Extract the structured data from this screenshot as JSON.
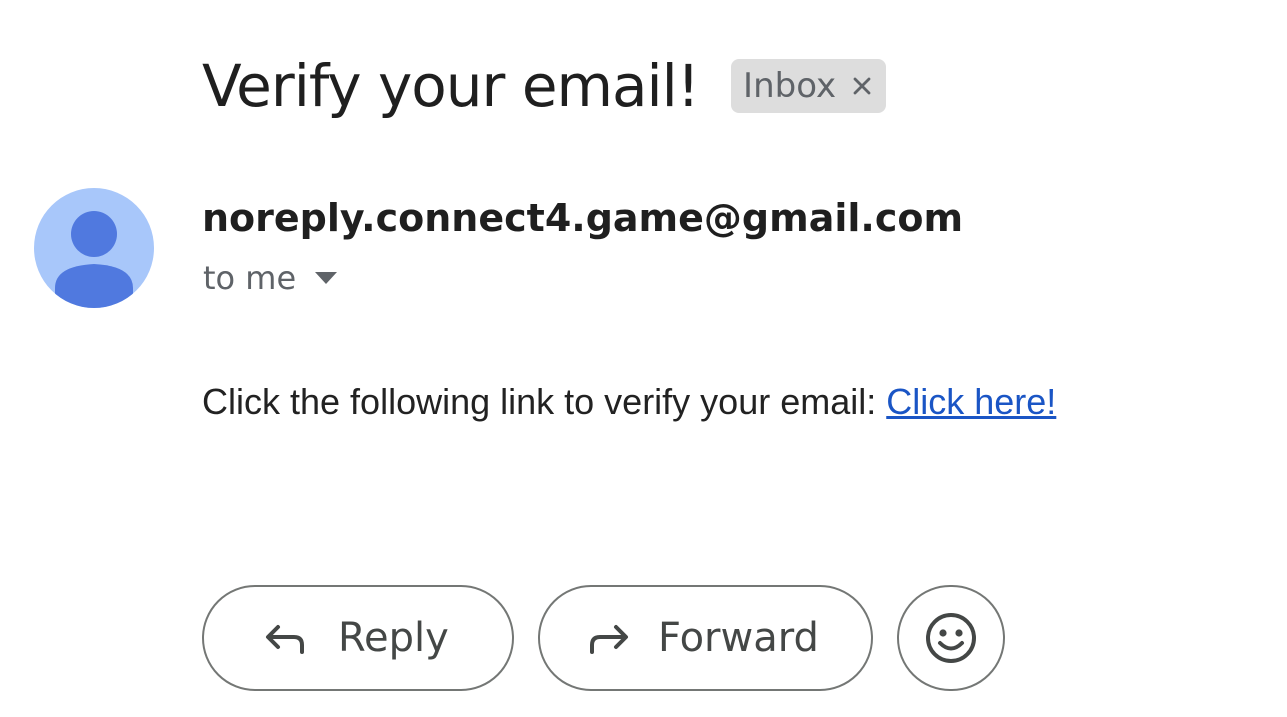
{
  "message": {
    "subject": "Verify your email!",
    "label": "Inbox",
    "sender": "noreply.connect4.game@gmail.com",
    "recipient": "to me",
    "body_text": "Click the following link to verify your email: ",
    "link_text": "Click here!"
  },
  "actions": {
    "reply_label": "Reply",
    "forward_label": "Forward"
  },
  "icons": {
    "label_remove": "close-icon",
    "avatar": "person-icon",
    "details": "caret-down-icon",
    "reply": "reply-arrow-icon",
    "forward": "forward-arrow-icon",
    "emoji": "smiley-icon"
  },
  "colors": {
    "avatar_bg": "#a8c7fa",
    "avatar_fg": "#5079df",
    "link": "#1a55c5",
    "label_chip": "#dddddd"
  }
}
